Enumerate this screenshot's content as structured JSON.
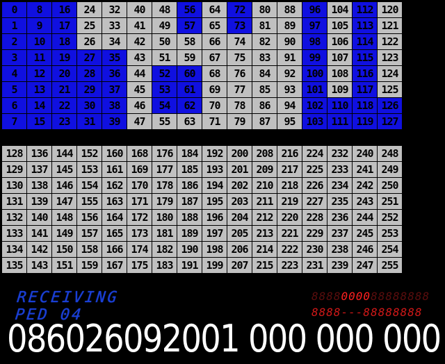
{
  "grid_top": {
    "cells": [
      {
        "label": "0",
        "on": true
      },
      {
        "label": "8",
        "on": true
      },
      {
        "label": "16",
        "on": true
      },
      {
        "label": "24",
        "on": false
      },
      {
        "label": "32",
        "on": false
      },
      {
        "label": "40",
        "on": false
      },
      {
        "label": "48",
        "on": false
      },
      {
        "label": "56",
        "on": true
      },
      {
        "label": "64",
        "on": false
      },
      {
        "label": "72",
        "on": true
      },
      {
        "label": "80",
        "on": false
      },
      {
        "label": "88",
        "on": false
      },
      {
        "label": "96",
        "on": true
      },
      {
        "label": "104",
        "on": false
      },
      {
        "label": "112",
        "on": true
      },
      {
        "label": "120",
        "on": false
      },
      {
        "label": "1",
        "on": true
      },
      {
        "label": "9",
        "on": true
      },
      {
        "label": "17",
        "on": true
      },
      {
        "label": "25",
        "on": false
      },
      {
        "label": "33",
        "on": false
      },
      {
        "label": "41",
        "on": false
      },
      {
        "label": "49",
        "on": false
      },
      {
        "label": "57",
        "on": true
      },
      {
        "label": "65",
        "on": false
      },
      {
        "label": "73",
        "on": true
      },
      {
        "label": "81",
        "on": false
      },
      {
        "label": "89",
        "on": false
      },
      {
        "label": "97",
        "on": true
      },
      {
        "label": "105",
        "on": false
      },
      {
        "label": "113",
        "on": true
      },
      {
        "label": "121",
        "on": false
      },
      {
        "label": "2",
        "on": true
      },
      {
        "label": "10",
        "on": true
      },
      {
        "label": "18",
        "on": true
      },
      {
        "label": "26",
        "on": false
      },
      {
        "label": "34",
        "on": false
      },
      {
        "label": "42",
        "on": false
      },
      {
        "label": "50",
        "on": false
      },
      {
        "label": "58",
        "on": false
      },
      {
        "label": "66",
        "on": false
      },
      {
        "label": "74",
        "on": false
      },
      {
        "label": "82",
        "on": false
      },
      {
        "label": "90",
        "on": false
      },
      {
        "label": "98",
        "on": true
      },
      {
        "label": "106",
        "on": false
      },
      {
        "label": "114",
        "on": true
      },
      {
        "label": "122",
        "on": false
      },
      {
        "label": "3",
        "on": true
      },
      {
        "label": "11",
        "on": true
      },
      {
        "label": "19",
        "on": true
      },
      {
        "label": "27",
        "on": true
      },
      {
        "label": "35",
        "on": true
      },
      {
        "label": "43",
        "on": false
      },
      {
        "label": "51",
        "on": false
      },
      {
        "label": "59",
        "on": false
      },
      {
        "label": "67",
        "on": false
      },
      {
        "label": "75",
        "on": false
      },
      {
        "label": "83",
        "on": false
      },
      {
        "label": "91",
        "on": false
      },
      {
        "label": "99",
        "on": true
      },
      {
        "label": "107",
        "on": false
      },
      {
        "label": "115",
        "on": true
      },
      {
        "label": "123",
        "on": false
      },
      {
        "label": "4",
        "on": true
      },
      {
        "label": "12",
        "on": true
      },
      {
        "label": "20",
        "on": true
      },
      {
        "label": "28",
        "on": true
      },
      {
        "label": "36",
        "on": true
      },
      {
        "label": "44",
        "on": false
      },
      {
        "label": "52",
        "on": true
      },
      {
        "label": "60",
        "on": true
      },
      {
        "label": "68",
        "on": false
      },
      {
        "label": "76",
        "on": false
      },
      {
        "label": "84",
        "on": false
      },
      {
        "label": "92",
        "on": false
      },
      {
        "label": "100",
        "on": true
      },
      {
        "label": "108",
        "on": false
      },
      {
        "label": "116",
        "on": true
      },
      {
        "label": "124",
        "on": false
      },
      {
        "label": "5",
        "on": true
      },
      {
        "label": "13",
        "on": true
      },
      {
        "label": "21",
        "on": true
      },
      {
        "label": "29",
        "on": true
      },
      {
        "label": "37",
        "on": true
      },
      {
        "label": "45",
        "on": false
      },
      {
        "label": "53",
        "on": true
      },
      {
        "label": "61",
        "on": true
      },
      {
        "label": "69",
        "on": false
      },
      {
        "label": "77",
        "on": false
      },
      {
        "label": "85",
        "on": false
      },
      {
        "label": "93",
        "on": false
      },
      {
        "label": "101",
        "on": true
      },
      {
        "label": "109",
        "on": false
      },
      {
        "label": "117",
        "on": true
      },
      {
        "label": "125",
        "on": false
      },
      {
        "label": "6",
        "on": true
      },
      {
        "label": "14",
        "on": true
      },
      {
        "label": "22",
        "on": true
      },
      {
        "label": "30",
        "on": true
      },
      {
        "label": "38",
        "on": true
      },
      {
        "label": "46",
        "on": false
      },
      {
        "label": "54",
        "on": true
      },
      {
        "label": "62",
        "on": true
      },
      {
        "label": "70",
        "on": false
      },
      {
        "label": "78",
        "on": false
      },
      {
        "label": "86",
        "on": false
      },
      {
        "label": "94",
        "on": false
      },
      {
        "label": "102",
        "on": true
      },
      {
        "label": "110",
        "on": true
      },
      {
        "label": "118",
        "on": true
      },
      {
        "label": "126",
        "on": true
      },
      {
        "label": "7",
        "on": true
      },
      {
        "label": "15",
        "on": true
      },
      {
        "label": "23",
        "on": true
      },
      {
        "label": "31",
        "on": true
      },
      {
        "label": "39",
        "on": true
      },
      {
        "label": "47",
        "on": false
      },
      {
        "label": "55",
        "on": false
      },
      {
        "label": "63",
        "on": false
      },
      {
        "label": "71",
        "on": false
      },
      {
        "label": "79",
        "on": false
      },
      {
        "label": "87",
        "on": false
      },
      {
        "label": "95",
        "on": false
      },
      {
        "label": "103",
        "on": true
      },
      {
        "label": "111",
        "on": true
      },
      {
        "label": "119",
        "on": true
      },
      {
        "label": "127",
        "on": true
      }
    ]
  },
  "grid_bottom": {
    "cells": [
      {
        "label": "128",
        "on": false
      },
      {
        "label": "136",
        "on": false
      },
      {
        "label": "144",
        "on": false
      },
      {
        "label": "152",
        "on": false
      },
      {
        "label": "160",
        "on": false
      },
      {
        "label": "168",
        "on": false
      },
      {
        "label": "176",
        "on": false
      },
      {
        "label": "184",
        "on": false
      },
      {
        "label": "192",
        "on": false
      },
      {
        "label": "200",
        "on": false
      },
      {
        "label": "208",
        "on": false
      },
      {
        "label": "216",
        "on": false
      },
      {
        "label": "224",
        "on": false
      },
      {
        "label": "232",
        "on": false
      },
      {
        "label": "240",
        "on": false
      },
      {
        "label": "248",
        "on": false
      },
      {
        "label": "129",
        "on": false
      },
      {
        "label": "137",
        "on": false
      },
      {
        "label": "145",
        "on": false
      },
      {
        "label": "153",
        "on": false
      },
      {
        "label": "161",
        "on": false
      },
      {
        "label": "169",
        "on": false
      },
      {
        "label": "177",
        "on": false
      },
      {
        "label": "185",
        "on": false
      },
      {
        "label": "193",
        "on": false
      },
      {
        "label": "201",
        "on": false
      },
      {
        "label": "209",
        "on": false
      },
      {
        "label": "217",
        "on": false
      },
      {
        "label": "225",
        "on": false
      },
      {
        "label": "233",
        "on": false
      },
      {
        "label": "241",
        "on": false
      },
      {
        "label": "249",
        "on": false
      },
      {
        "label": "130",
        "on": false
      },
      {
        "label": "138",
        "on": false
      },
      {
        "label": "146",
        "on": false
      },
      {
        "label": "154",
        "on": false
      },
      {
        "label": "162",
        "on": false
      },
      {
        "label": "170",
        "on": false
      },
      {
        "label": "178",
        "on": false
      },
      {
        "label": "186",
        "on": false
      },
      {
        "label": "194",
        "on": false
      },
      {
        "label": "202",
        "on": false
      },
      {
        "label": "210",
        "on": false
      },
      {
        "label": "218",
        "on": false
      },
      {
        "label": "226",
        "on": false
      },
      {
        "label": "234",
        "on": false
      },
      {
        "label": "242",
        "on": false
      },
      {
        "label": "250",
        "on": false
      },
      {
        "label": "131",
        "on": false
      },
      {
        "label": "139",
        "on": false
      },
      {
        "label": "147",
        "on": false
      },
      {
        "label": "155",
        "on": false
      },
      {
        "label": "163",
        "on": false
      },
      {
        "label": "171",
        "on": false
      },
      {
        "label": "179",
        "on": false
      },
      {
        "label": "187",
        "on": false
      },
      {
        "label": "195",
        "on": false
      },
      {
        "label": "203",
        "on": false
      },
      {
        "label": "211",
        "on": false
      },
      {
        "label": "219",
        "on": false
      },
      {
        "label": "227",
        "on": false
      },
      {
        "label": "235",
        "on": false
      },
      {
        "label": "243",
        "on": false
      },
      {
        "label": "251",
        "on": false
      },
      {
        "label": "132",
        "on": false
      },
      {
        "label": "140",
        "on": false
      },
      {
        "label": "148",
        "on": false
      },
      {
        "label": "156",
        "on": false
      },
      {
        "label": "164",
        "on": false
      },
      {
        "label": "172",
        "on": false
      },
      {
        "label": "180",
        "on": false
      },
      {
        "label": "188",
        "on": false
      },
      {
        "label": "196",
        "on": false
      },
      {
        "label": "204",
        "on": false
      },
      {
        "label": "212",
        "on": false
      },
      {
        "label": "220",
        "on": false
      },
      {
        "label": "228",
        "on": false
      },
      {
        "label": "236",
        "on": false
      },
      {
        "label": "244",
        "on": false
      },
      {
        "label": "252",
        "on": false
      },
      {
        "label": "133",
        "on": false
      },
      {
        "label": "141",
        "on": false
      },
      {
        "label": "149",
        "on": false
      },
      {
        "label": "157",
        "on": false
      },
      {
        "label": "165",
        "on": false
      },
      {
        "label": "173",
        "on": false
      },
      {
        "label": "181",
        "on": false
      },
      {
        "label": "189",
        "on": false
      },
      {
        "label": "197",
        "on": false
      },
      {
        "label": "205",
        "on": false
      },
      {
        "label": "213",
        "on": false
      },
      {
        "label": "221",
        "on": false
      },
      {
        "label": "229",
        "on": false
      },
      {
        "label": "237",
        "on": false
      },
      {
        "label": "245",
        "on": false
      },
      {
        "label": "253",
        "on": false
      },
      {
        "label": "134",
        "on": false
      },
      {
        "label": "142",
        "on": false
      },
      {
        "label": "150",
        "on": false
      },
      {
        "label": "158",
        "on": false
      },
      {
        "label": "166",
        "on": false
      },
      {
        "label": "174",
        "on": false
      },
      {
        "label": "182",
        "on": false
      },
      {
        "label": "190",
        "on": false
      },
      {
        "label": "198",
        "on": false
      },
      {
        "label": "206",
        "on": false
      },
      {
        "label": "214",
        "on": false
      },
      {
        "label": "222",
        "on": false
      },
      {
        "label": "230",
        "on": false
      },
      {
        "label": "238",
        "on": false
      },
      {
        "label": "246",
        "on": false
      },
      {
        "label": "254",
        "on": false
      },
      {
        "label": "135",
        "on": false
      },
      {
        "label": "143",
        "on": false
      },
      {
        "label": "151",
        "on": false
      },
      {
        "label": "159",
        "on": false
      },
      {
        "label": "167",
        "on": false
      },
      {
        "label": "175",
        "on": false
      },
      {
        "label": "183",
        "on": false
      },
      {
        "label": "191",
        "on": false
      },
      {
        "label": "199",
        "on": false
      },
      {
        "label": "207",
        "on": false
      },
      {
        "label": "215",
        "on": false
      },
      {
        "label": "223",
        "on": false
      },
      {
        "label": "231",
        "on": false
      },
      {
        "label": "239",
        "on": false
      },
      {
        "label": "247",
        "on": false
      },
      {
        "label": "255",
        "on": false
      }
    ]
  },
  "status": {
    "left_banner": "RECEIVING PED 04",
    "right_top_dim": "8888",
    "right_top_lit": "0000",
    "right_top_tail": "88888888",
    "right_bottom": "8888---88888888",
    "big_number": "086026092001 000 000 000"
  },
  "colors": {
    "on": "#1010e0",
    "off": "#c0c0c0",
    "banner": "#1a3fd6",
    "segment_red": "#ff2020"
  }
}
